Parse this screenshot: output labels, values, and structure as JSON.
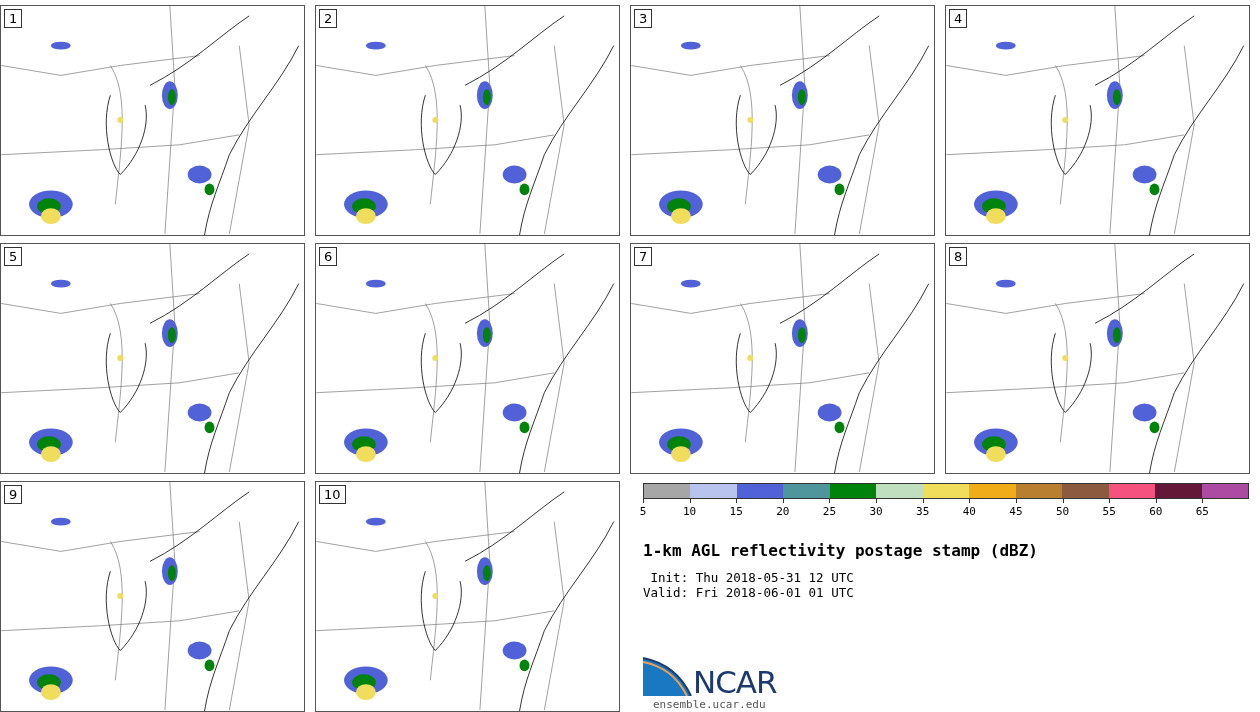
{
  "panels": [
    {
      "label": "1"
    },
    {
      "label": "2"
    },
    {
      "label": "3"
    },
    {
      "label": "4"
    },
    {
      "label": "5"
    },
    {
      "label": "6"
    },
    {
      "label": "7"
    },
    {
      "label": "8"
    },
    {
      "label": "9"
    },
    {
      "label": "10"
    }
  ],
  "colorbar": {
    "segments": [
      {
        "color": "#a6a6a6"
      },
      {
        "color": "#b8c3ee"
      },
      {
        "color": "#5161d8"
      },
      {
        "color": "#4e969b"
      },
      {
        "color": "#00830a"
      },
      {
        "color": "#bfdfbf"
      },
      {
        "color": "#f0dd5c"
      },
      {
        "color": "#f0ac19"
      },
      {
        "color": "#b97f30"
      },
      {
        "color": "#8c5a3f"
      },
      {
        "color": "#f5527f"
      },
      {
        "color": "#631838"
      },
      {
        "color": "#ad4ba3"
      }
    ],
    "ticks": [
      "5",
      "10",
      "15",
      "20",
      "25",
      "30",
      "35",
      "40",
      "45",
      "50",
      "55",
      "60",
      "65"
    ]
  },
  "title": "1-km AGL reflectivity postage stamp (dBZ)",
  "init": " Init: Thu 2018-05-31 12 UTC",
  "valid": "Valid: Fri 2018-06-01 01 UTC",
  "logo": {
    "text": "NCAR",
    "url": "ensemble.ucar.edu"
  }
}
